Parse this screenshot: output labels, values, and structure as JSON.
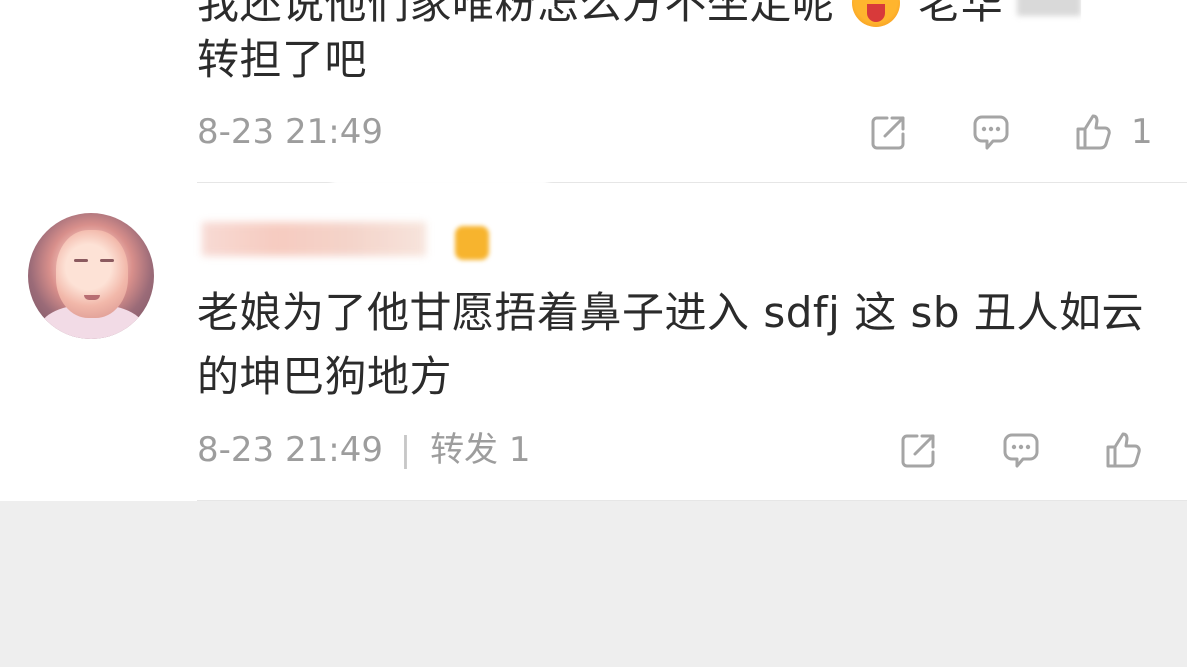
{
  "comments": [
    {
      "text_line_1_prefix": "我还说他们家唯粉怎么方不坐定呢",
      "text_line_1_suffix": "老华",
      "text_line_2": "转担了吧",
      "time": "8-23 21:49",
      "likes": "1"
    },
    {
      "text_line_1": "老娘为了他甘愿捂着鼻子进入 sdfj 这 sb 丑人如云",
      "text_line_2": "的坤巴狗地方",
      "time": "8-23 21:49",
      "separator": "|",
      "forward_label": "转发 1"
    }
  ],
  "icons": {
    "share": "share-icon",
    "comment": "comment-icon",
    "like": "thumbs-up-icon",
    "emoji": "laughing-emoji-icon",
    "avatar": "baby-avatar"
  },
  "colors": {
    "text": "#2b2b2b",
    "meta": "#9d9d9d",
    "divider": "#e6e6e6",
    "background": "#eeeeee"
  }
}
